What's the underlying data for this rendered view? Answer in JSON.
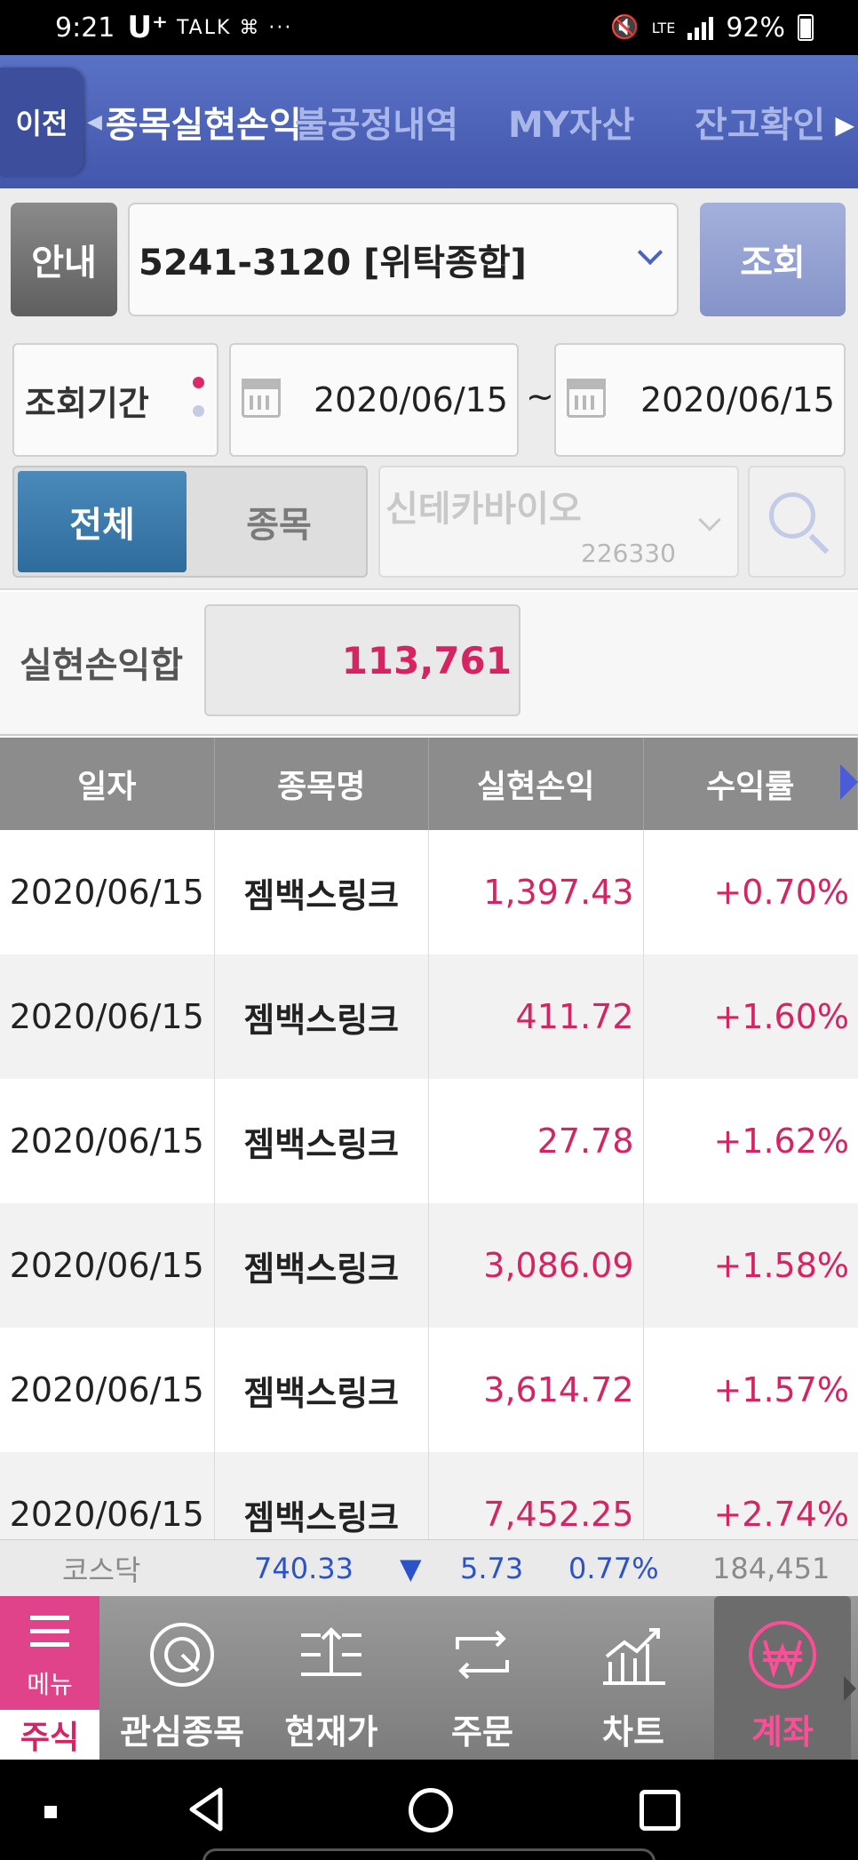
{
  "status_bar": {
    "time": "9:21",
    "carrier": "U⁺",
    "extra_icons": "TALK ⌘ ···",
    "network": "LTE",
    "battery": "92%"
  },
  "nav": {
    "back": "이전",
    "tabs": [
      "종목실현손익",
      "불공정내역",
      "MY자산",
      "잔고확인"
    ],
    "active_tab": 0,
    "more_arrow": "▶"
  },
  "account": {
    "guide_button": "안내",
    "account_value": "5241-3120 [위탁종합]",
    "query_button": "조회"
  },
  "period": {
    "label": "조회기간",
    "from": "2020/06/15",
    "separator": "~",
    "to": "2020/06/15"
  },
  "filter": {
    "all_label": "전체",
    "item_label": "종목",
    "stock_name": "신테카바이오",
    "stock_code": "226330"
  },
  "summary": {
    "label": "실현손익합",
    "value": "113,761"
  },
  "table": {
    "headers": [
      "일자",
      "종목명",
      "실현손익",
      "수익률"
    ],
    "rows": [
      {
        "date": "2020/06/15",
        "name": "젬백스링크",
        "profit": "1,397.43",
        "rate": "+0.70%"
      },
      {
        "date": "2020/06/15",
        "name": "젬백스링크",
        "profit": "411.72",
        "rate": "+1.60%"
      },
      {
        "date": "2020/06/15",
        "name": "젬백스링크",
        "profit": "27.78",
        "rate": "+1.62%"
      },
      {
        "date": "2020/06/15",
        "name": "젬백스링크",
        "profit": "3,086.09",
        "rate": "+1.58%"
      },
      {
        "date": "2020/06/15",
        "name": "젬백스링크",
        "profit": "3,614.72",
        "rate": "+1.57%"
      },
      {
        "date": "2020/06/15",
        "name": "젬백스링크",
        "profit": "7,452.25",
        "rate": "+2.74%"
      }
    ]
  },
  "ticker": {
    "name": "코스닥",
    "index": "740.33",
    "direction": "▼",
    "change": "5.73",
    "percent": "0.77%",
    "volume": "184,451"
  },
  "bottom_nav": {
    "menu": "메뉴",
    "stock": "주식",
    "items": [
      "관심종목",
      "현재가",
      "주문",
      "차트",
      "계좌"
    ],
    "active_item": 4
  },
  "colors": {
    "nav_blue": "#4a5fb5",
    "profit_pink": "#d62463",
    "index_blue": "#2b53c9",
    "menu_pink": "#e0438a"
  }
}
